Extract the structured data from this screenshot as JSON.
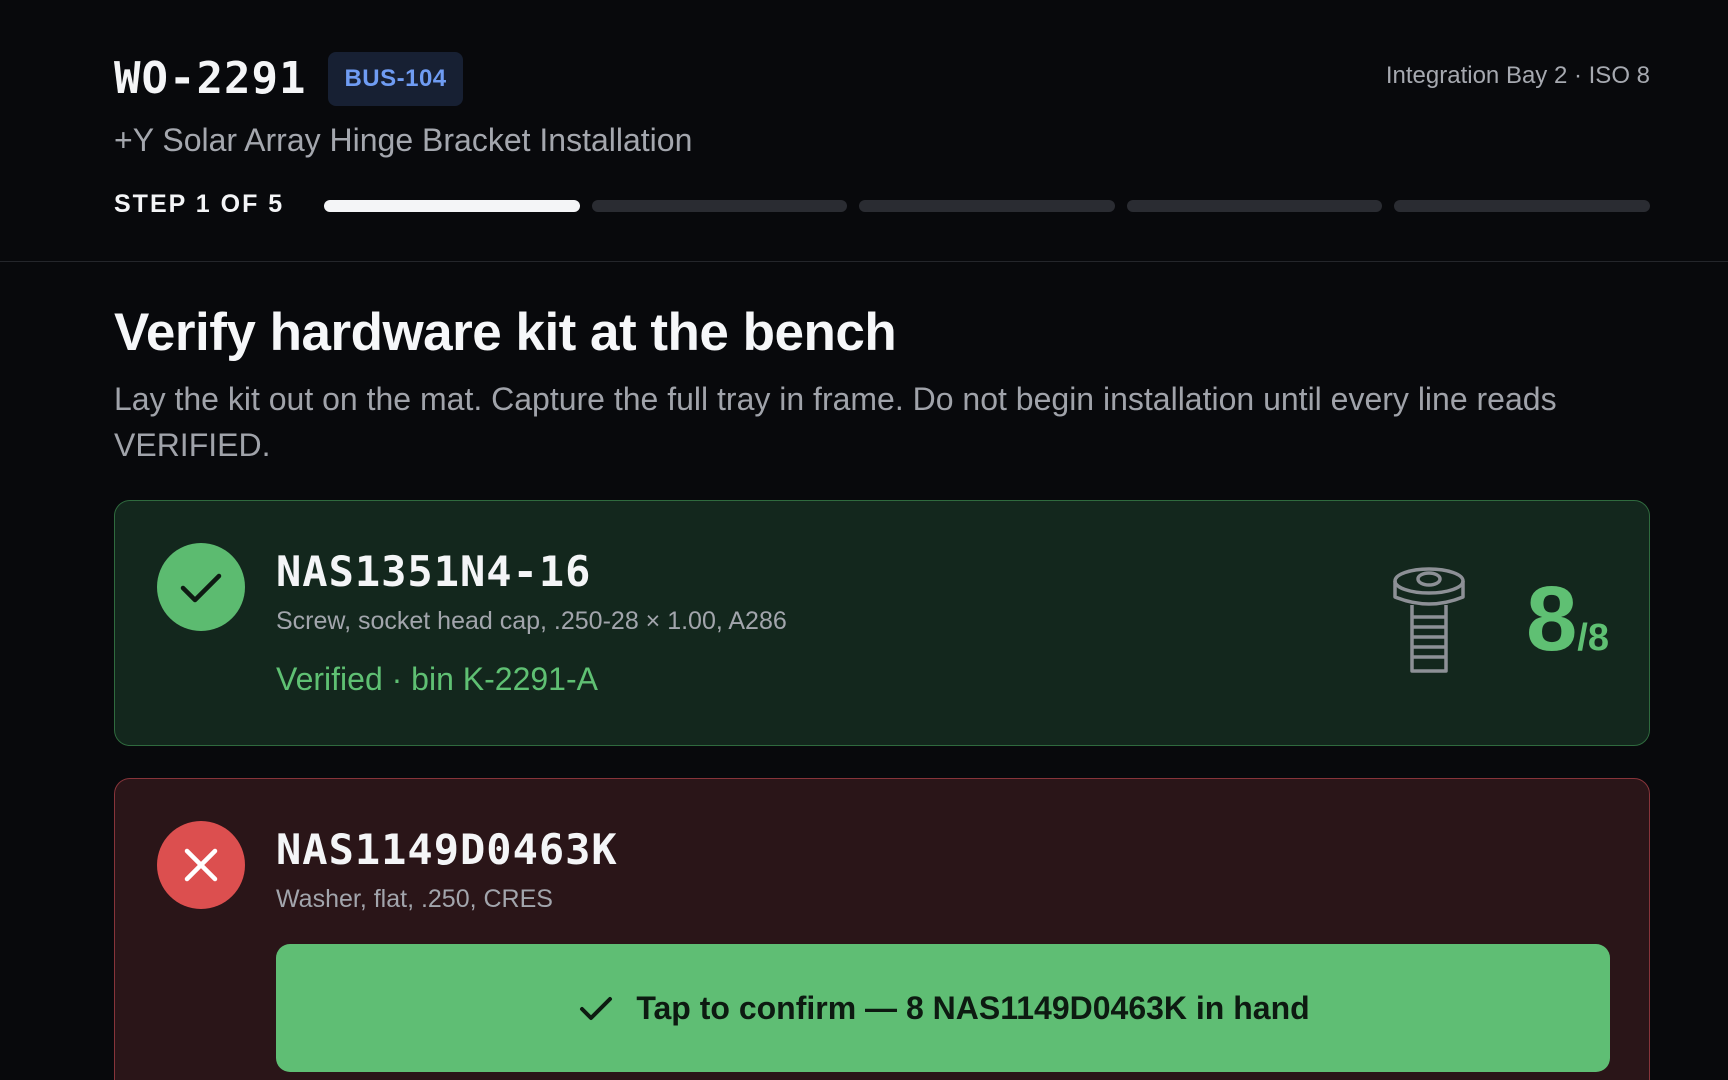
{
  "header": {
    "work_order": "WO-2291",
    "bus_badge": "BUS-104",
    "location": "Integration Bay 2 · ISO 8",
    "subtitle": "+Y Solar Array Hinge Bracket Installation",
    "step_label": "STEP 1 OF 5",
    "progress": {
      "current_step": 1,
      "total_steps": 5
    }
  },
  "step": {
    "title": "Verify hardware kit at the bench",
    "description": "Lay the kit out on the mat. Capture the full tray in frame. Do not begin installation until every line reads VERIFIED."
  },
  "items": [
    {
      "status": "verified",
      "status_icon": "check-icon",
      "part_number": "NAS1351N4-16",
      "description": "Screw, socket head cap, .250-28 × 1.00, A286",
      "verified_text": "Verified · bin K-2291-A",
      "part_icon": "bolt-icon",
      "count": "8",
      "count_of": "/8"
    },
    {
      "status": "missing",
      "status_icon": "x-icon",
      "part_number": "NAS1149D0463K",
      "description": "Washer, flat, .250, CRES",
      "confirm_label": "Tap to confirm — 8 NAS1149D0463K in hand"
    }
  ],
  "colors": {
    "background": "#08090c",
    "verified_green": "#5fc073",
    "error_red": "#dc4f4f",
    "badge_blue": "#6f9cf3"
  }
}
